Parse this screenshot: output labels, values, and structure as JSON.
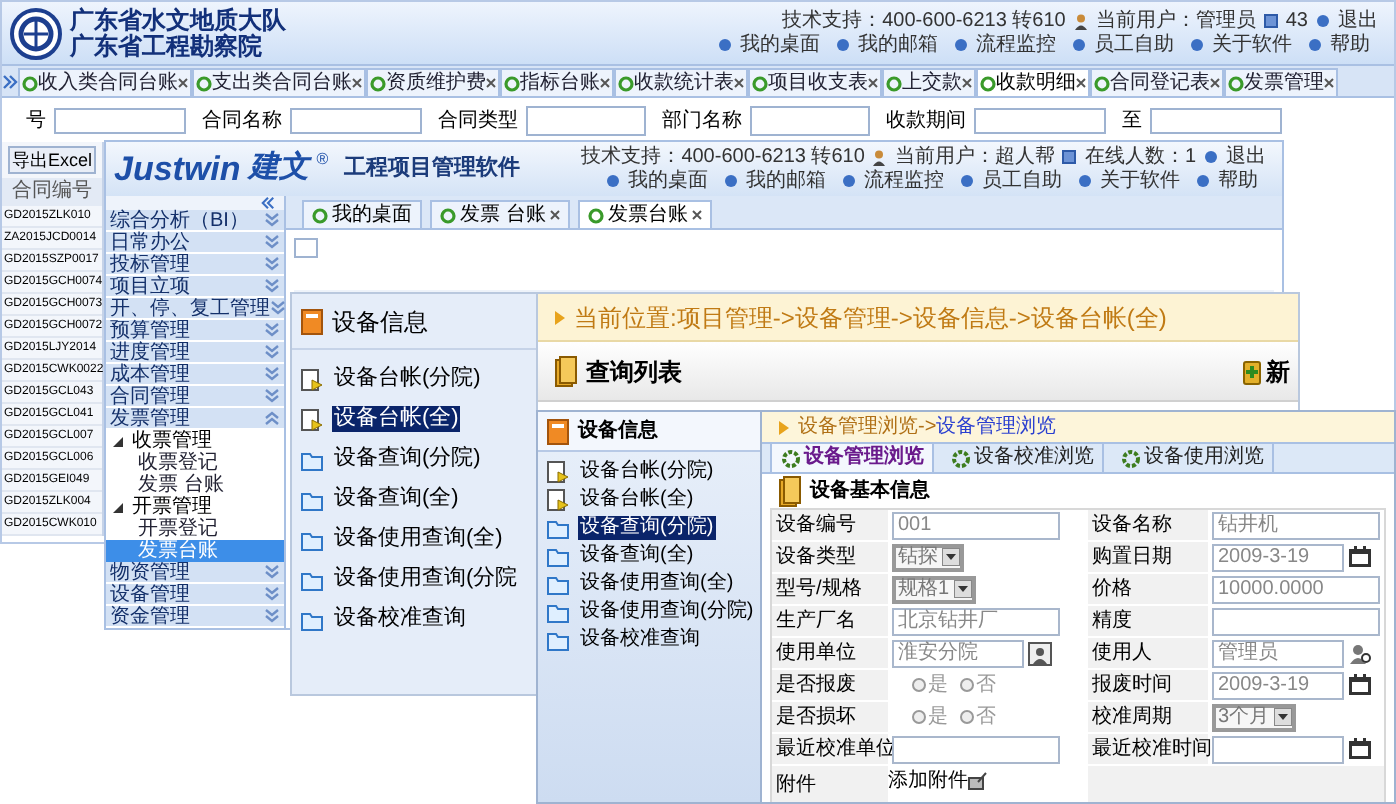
{
  "back_window": {
    "org_names": [
      "广东省水文地质大队",
      "广东省工程勘察院"
    ],
    "support": "技术支持：400-600-6213 转610",
    "user": "当前用户：管理员",
    "count": "43",
    "logout": "退出",
    "links": [
      "我的桌面",
      "我的邮箱",
      "流程监控",
      "员工自助",
      "关于软件",
      "帮助"
    ],
    "tabs": [
      {
        "label": "收入类合同台账",
        "selected": false
      },
      {
        "label": "支出类合同台账",
        "selected": false
      },
      {
        "label": "资质维护费",
        "selected": false
      },
      {
        "label": "指标台账",
        "selected": false
      },
      {
        "label": "收款统计表",
        "selected": false
      },
      {
        "label": "项目收支表",
        "selected": false
      },
      {
        "label": "上交款",
        "selected": false
      },
      {
        "label": "收款明细",
        "selected": true
      },
      {
        "label": "合同登记表",
        "selected": false
      },
      {
        "label": "发票管理",
        "selected": false
      }
    ],
    "filters": [
      {
        "label": "号",
        "kind": "text"
      },
      {
        "label": "合同名称",
        "kind": "text"
      },
      {
        "label": "合同类型",
        "kind": "select"
      },
      {
        "label": "部门名称",
        "kind": "select"
      },
      {
        "label": "收款期间",
        "kind": "text"
      },
      {
        "label": "至",
        "kind": "text"
      }
    ],
    "export_button": "导出Excel",
    "table": {
      "columns": [
        "合同编号"
      ],
      "rows": [
        "GD2015ZLK010",
        "ZA2015JCD0014",
        "GD2015SZP0017",
        "GD2015GCH0074",
        "GD2015GCH0073",
        "GD2015GCH0072",
        "GD2015LJY2014",
        "GD2015CWK0022",
        "GD2015GCL043",
        "GD2015GCL041",
        "GD2015GCL007",
        "GD2015GCL006",
        "GD2015GEI049",
        "GD2015ZLK004",
        "GD2015CWK010"
      ]
    }
  },
  "middle_window": {
    "brand": "Justwin",
    "brand_cn": "建文",
    "brand_mark": "®",
    "product": "工程项目管理软件",
    "support": "技术支持：400-600-6213 转610",
    "user": "当前用户：超人帮",
    "online": "在线人数：1",
    "logout": "退出",
    "links": [
      "我的桌面",
      "我的邮箱",
      "流程监控",
      "员工自助",
      "关于软件",
      "帮助"
    ],
    "tabs": [
      {
        "label": "我的桌面",
        "closable": false,
        "selected": false
      },
      {
        "label": "发票 台账",
        "closable": true,
        "selected": false
      },
      {
        "label": "发票台账",
        "closable": true,
        "selected": true
      }
    ],
    "sidebar": {
      "items": [
        {
          "label": "综合分析（BI）",
          "expanded": false
        },
        {
          "label": "日常办公",
          "expanded": false
        },
        {
          "label": "投标管理",
          "expanded": false
        },
        {
          "label": "项目立项",
          "expanded": false
        },
        {
          "label": "开、停、复工管理",
          "expanded": false
        },
        {
          "label": "预算管理",
          "expanded": false
        },
        {
          "label": "进度管理",
          "expanded": false
        },
        {
          "label": "成本管理",
          "expanded": false
        },
        {
          "label": "合同管理",
          "expanded": false
        },
        {
          "label": "发票管理",
          "expanded": true,
          "children": [
            {
              "label": "收票管理",
              "expanded": true,
              "children": [
                {
                  "label": "收票登记",
                  "selected": false
                },
                {
                  "label": "发票 台账",
                  "selected": false
                }
              ]
            },
            {
              "label": "开票管理",
              "expanded": true,
              "children": [
                {
                  "label": "开票登记",
                  "selected": false
                },
                {
                  "label": "发票台账",
                  "selected": true
                }
              ]
            }
          ]
        },
        {
          "label": "物资管理",
          "expanded": false
        },
        {
          "label": "设备管理",
          "expanded": false
        },
        {
          "label": "资金管理",
          "expanded": false
        }
      ]
    }
  },
  "third_window": {
    "panel_title": "设备信息",
    "items": [
      {
        "label": "设备台帐(分院)",
        "kind": "document",
        "selected": false
      },
      {
        "label": "设备台帐(全)",
        "kind": "document",
        "selected": true
      },
      {
        "label": "设备查询(分院)",
        "kind": "folder",
        "selected": false
      },
      {
        "label": "设备查询(全)",
        "kind": "folder",
        "selected": false
      },
      {
        "label": "设备使用查询(全)",
        "kind": "folder",
        "selected": false
      },
      {
        "label": "设备使用查询(分院",
        "kind": "folder",
        "selected": false
      },
      {
        "label": "设备校准查询",
        "kind": "folder",
        "selected": false
      }
    ],
    "breadcrumb": "当前位置:项目管理->设备管理->设备信息->设备台帐(全)",
    "list_title": "查询列表",
    "add_button": "新"
  },
  "front_window": {
    "panel_title": "设备信息",
    "tree": [
      {
        "label": "设备台帐(分院)",
        "kind": "document",
        "selected": false
      },
      {
        "label": "设备台帐(全)",
        "kind": "document",
        "selected": false
      },
      {
        "label": "设备查询(分院)",
        "kind": "folder",
        "selected": true
      },
      {
        "label": "设备查询(全)",
        "kind": "folder",
        "selected": false
      },
      {
        "label": "设备使用查询(全)",
        "kind": "folder",
        "selected": false
      },
      {
        "label": "设备使用查询(分院)",
        "kind": "folder",
        "selected": false
      },
      {
        "label": "设备校准查询",
        "kind": "folder",
        "selected": false
      }
    ],
    "breadcrumb_parent": "设备管理浏览->",
    "breadcrumb_current": "设备管理浏览",
    "tabs": [
      {
        "label": "设备管理浏览",
        "selected": true
      },
      {
        "label": "设备校准浏览",
        "selected": false
      },
      {
        "label": "设备使用浏览",
        "selected": false
      }
    ],
    "section_title": "设备基本信息",
    "fields": [
      {
        "label": "设备编号",
        "kind": "text",
        "value": "001"
      },
      {
        "label": "设备名称",
        "kind": "text",
        "value": "钻井机"
      },
      {
        "label": "设备类型",
        "kind": "select",
        "value": "钻探"
      },
      {
        "label": "购置日期",
        "kind": "date",
        "value": "2009-3-19"
      },
      {
        "label": "型号/规格",
        "kind": "select",
        "value": "规格1"
      },
      {
        "label": "价格",
        "kind": "text",
        "value": "10000.0000"
      },
      {
        "label": "生产厂名",
        "kind": "text",
        "value": "北京钻井厂"
      },
      {
        "label": "精度",
        "kind": "text"
      },
      {
        "label": "使用单位",
        "kind": "picker",
        "value": "淮安分院"
      },
      {
        "label": "使用人",
        "kind": "person",
        "value": "管理员"
      },
      {
        "label": "是否报废",
        "kind": "radio",
        "options": [
          {
            "label": "是",
            "selected": false
          },
          {
            "label": "否",
            "selected": false
          }
        ]
      },
      {
        "label": "报废时间",
        "kind": "date",
        "value": "2009-3-19"
      },
      {
        "label": "是否损坏",
        "kind": "radio",
        "options": [
          {
            "label": "是",
            "selected": false
          },
          {
            "label": "否",
            "selected": false
          }
        ]
      },
      {
        "label": "校准周期",
        "kind": "select",
        "value": "3个月"
      },
      {
        "label": "最近校准单位",
        "kind": "text"
      },
      {
        "label": "最近校准时间",
        "kind": "date"
      }
    ],
    "attachment": {
      "label": "附件",
      "link": "添加附件"
    }
  }
}
